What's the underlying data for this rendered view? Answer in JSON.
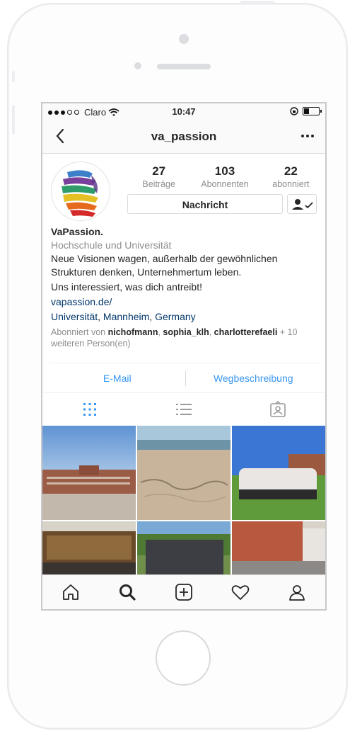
{
  "status_bar": {
    "carrier": "Claro",
    "time": "10:47"
  },
  "nav": {
    "title": "va_passion"
  },
  "profile": {
    "stats": [
      {
        "value": "27",
        "label": "Beiträge"
      },
      {
        "value": "103",
        "label": "Abonnenten"
      },
      {
        "value": "22",
        "label": "abonniert"
      }
    ],
    "message_button": "Nachricht",
    "name": "VaPassion.",
    "category": "Hochschule und Universität",
    "bio_line1": "Neue Visionen wagen, außerhalb der gewöhnlichen Strukturen denken, Unternehmertum leben.",
    "bio_line2": "Uns interessiert, was dich antreibt!",
    "website": "vapassion.de/",
    "location": {
      "a": "Universität",
      "b": "Mannheim",
      "c": "Germany",
      "sep": ", "
    },
    "followed_by": {
      "prefix": "Abonniert von",
      "users": [
        "nichofmann",
        "sophia_klh",
        "charlotterefaeli"
      ],
      "suffix": "+ 10 weiteren Person(en)"
    }
  },
  "contact": {
    "email": "E-Mail",
    "directions": "Wegbeschreibung"
  },
  "view_tabs": [
    "grid-icon",
    "list-icon",
    "tagged-icon"
  ],
  "posts": [
    {
      "name": "post-palace-square"
    },
    {
      "name": "post-beach-sand-writing"
    },
    {
      "name": "post-group-celebration"
    },
    {
      "name": "post-lecture-hall"
    },
    {
      "name": "post-group-park"
    },
    {
      "name": "post-palace-facade"
    }
  ],
  "tab_bar": [
    "home-icon",
    "search-icon",
    "add-icon",
    "heart-icon",
    "profile-icon"
  ],
  "colors": {
    "link": "#003569",
    "action": "#3897f0",
    "muted": "#8e8e8e"
  }
}
